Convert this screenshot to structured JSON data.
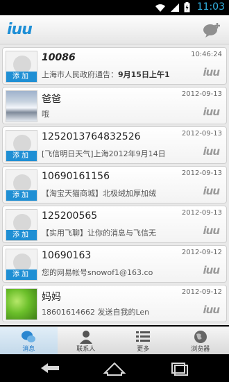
{
  "status_bar": {
    "time": "11:03"
  },
  "header": {
    "logo": "iuu"
  },
  "messages": [
    {
      "name": "10086",
      "preview_parts": [
        "上海市人民政府通告：",
        "9月15日上午1"
      ],
      "date": "10:46:24",
      "avatar": "default",
      "add_label": "添加",
      "mark": "iuu"
    },
    {
      "name": "爸爸",
      "preview": "哦",
      "date": "2012-09-13",
      "avatar": "snow",
      "mark": "iuu"
    },
    {
      "name": "1252013764832526",
      "preview": "[飞信明日天气]上海2012年9月14日",
      "date": "2012-09-13",
      "avatar": "default",
      "add_label": "添加",
      "mark": "iuu"
    },
    {
      "name": "10690161156",
      "preview": "【淘宝天猫商城】北极绒加厚加绒",
      "date": "2012-09-13",
      "avatar": "default",
      "add_label": "添加",
      "mark": "iuu"
    },
    {
      "name": "125200565",
      "preview": "【实用飞聊】让你的消息与飞信无",
      "date": "2012-09-13",
      "avatar": "default",
      "add_label": "添加",
      "mark": "iuu"
    },
    {
      "name": "10690163",
      "preview": "您的网易帐号snowof1@163.co",
      "date": "2012-09-12",
      "avatar": "default",
      "add_label": "添加",
      "mark": "iuu"
    },
    {
      "name": "妈妈",
      "preview": "18601614662 发送自我的Len",
      "date": "2012-09-12",
      "avatar": "green",
      "mark": "iuu"
    }
  ],
  "tabs": [
    {
      "label": "消息",
      "icon": "chat-bubbles-icon",
      "active": true
    },
    {
      "label": "联系人",
      "icon": "contacts-icon",
      "active": false
    },
    {
      "label": "更多",
      "icon": "list-icon",
      "active": false
    },
    {
      "label": "浏览器",
      "icon": "globe-icon",
      "active": false
    }
  ],
  "colors": {
    "accent": "#1f8fd4",
    "status_blue": "#33b5e5"
  }
}
